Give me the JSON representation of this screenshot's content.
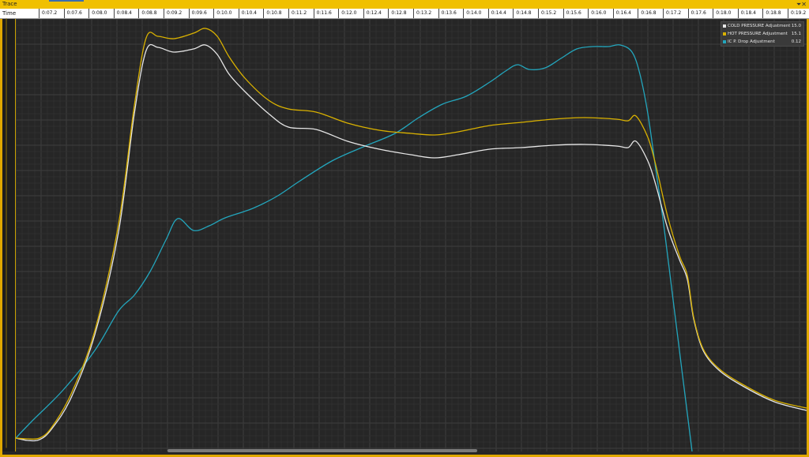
{
  "window": {
    "title": "Trace"
  },
  "timebar": {
    "label": "Time",
    "ticks": [
      "0:07.2",
      "0:07.6",
      "0:08.0",
      "0:08.4",
      "0:08.8",
      "0:09.2",
      "0:09.6",
      "0:10.0",
      "0:10.4",
      "0:10.8",
      "0:11.2",
      "0:11.6",
      "0:12.0",
      "0:12.4",
      "0:12.8",
      "0:13.2",
      "0:13.6",
      "0:14.0",
      "0:14.4",
      "0:14.8",
      "0:15.2",
      "0:15.6",
      "0:16.0",
      "0:16.4",
      "0:16.8",
      "0:17.2",
      "0:17.6",
      "0:18.0",
      "0:18.4",
      "0:18.8",
      "0:19.2"
    ]
  },
  "legend": [
    {
      "name": "COLD PRESSURE Adjustment",
      "value": "15.0",
      "color": "#e6e6e6"
    },
    {
      "name": "HOT PRESSURE Adjustment",
      "value": "15.1",
      "color": "#d9b100"
    },
    {
      "name": "IC P. Drop Adjustment",
      "value": "0.12",
      "color": "#23a6bd"
    }
  ],
  "colors": {
    "background": "#262626",
    "grid": "#3a3a3a",
    "accent": "#f0c000"
  }
}
